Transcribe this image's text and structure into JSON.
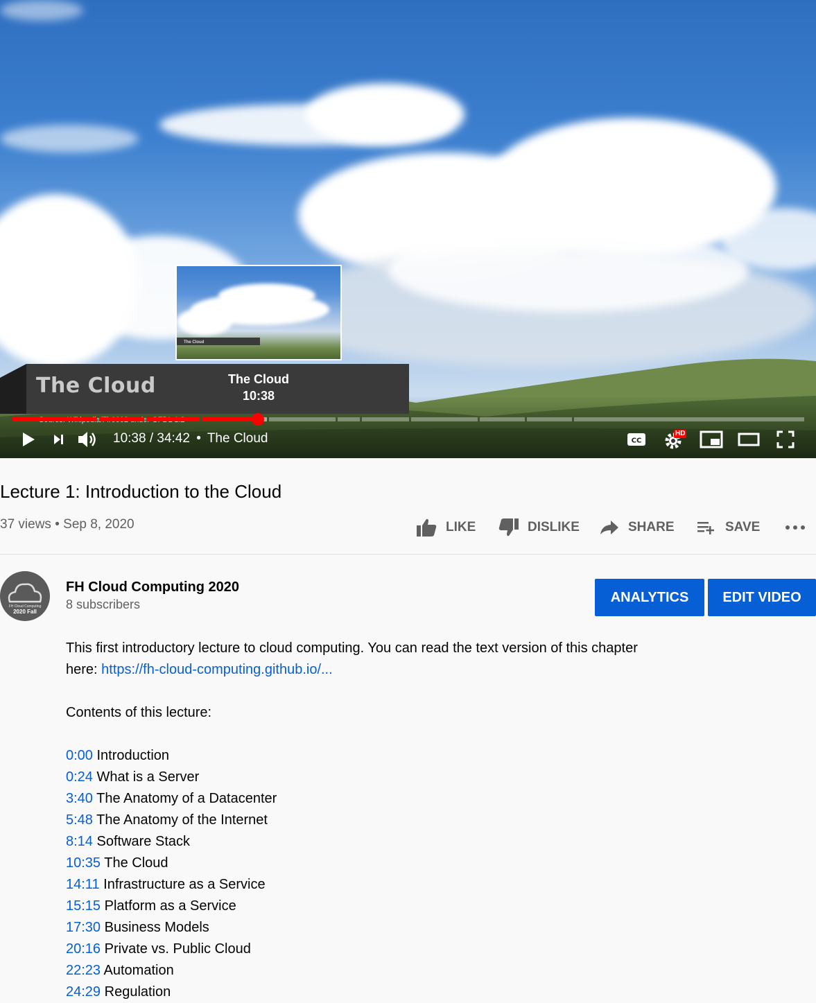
{
  "player": {
    "banner_title": "The Cloud",
    "banner_source": "Source: Wikipedia/Fir0002 under GFDL 1.2",
    "hover_chapter": "The Cloud",
    "hover_time": "10:38",
    "preview_label": "The Cloud",
    "time_display": "10:38 / 34:42",
    "chapter_separator": "•",
    "current_chapter": "The Cloud",
    "progress_fraction": 0.306,
    "hd_badge": "HD",
    "icons": [
      "play-icon",
      "next-icon",
      "volume-icon",
      "captions-icon",
      "settings-icon",
      "miniplayer-icon",
      "theater-icon",
      "fullscreen-icon"
    ]
  },
  "video": {
    "title": "Lecture 1: Introduction to the Cloud",
    "views": "37 views",
    "dot": "•",
    "date": "Sep 8, 2020"
  },
  "actions": {
    "like": "LIKE",
    "dislike": "DISLIKE",
    "share": "SHARE",
    "save": "SAVE"
  },
  "channel": {
    "name": "FH Cloud Computing 2020",
    "subscribers": "8 subscribers",
    "avatar_text_top": "FH Cloud Computing",
    "avatar_text_bottom": "2020 Fall"
  },
  "buttons": {
    "analytics": "ANALYTICS",
    "edit_video": "EDIT VIDEO"
  },
  "description": {
    "intro": "This first introductory lecture to cloud computing. You can read the text version of this chapter",
    "here_prefix": "here: ",
    "link": "https://fh-cloud-computing.github.io/...",
    "contents_heading": "Contents of this lecture:",
    "chapters": [
      {
        "time": "0:00",
        "title": "Introduction"
      },
      {
        "time": "0:24",
        "title": "What is a Server"
      },
      {
        "time": "3:40",
        "title": "The Anatomy of a Datacenter"
      },
      {
        "time": "5:48",
        "title": "The Anatomy of the Internet"
      },
      {
        "time": "8:14",
        "title": "Software Stack"
      },
      {
        "time": "10:35",
        "title": "The Cloud"
      },
      {
        "time": "14:11",
        "title": "Infrastructure as a Service"
      },
      {
        "time": "15:15",
        "title": "Platform as a Service"
      },
      {
        "time": "17:30",
        "title": "Business Models"
      },
      {
        "time": "20:16",
        "title": "Private vs. Public Cloud"
      },
      {
        "time": "22:23",
        "title": "Automation"
      },
      {
        "time": "24:29",
        "title": "Regulation"
      }
    ]
  },
  "colors": {
    "accent_blue": "#065fd4",
    "progress_red": "#ff0000"
  }
}
